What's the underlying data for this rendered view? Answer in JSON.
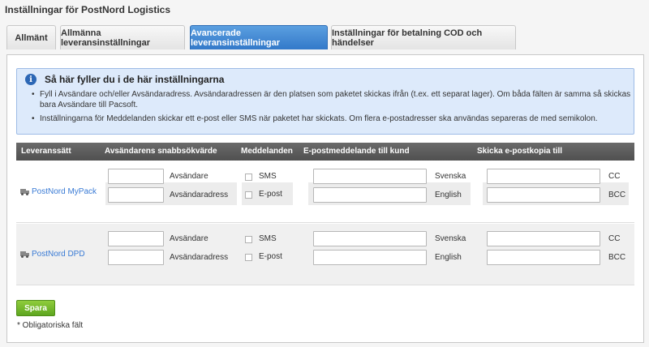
{
  "page": {
    "title": "Inställningar för PostNord Logistics"
  },
  "tabs": [
    {
      "label": "Allmänt",
      "active": false
    },
    {
      "label": "Allmänna leveransinställningar",
      "active": false
    },
    {
      "label": "Avancerade leveransinställningar",
      "active": true
    },
    {
      "label": "Inställningar för betalning COD och händelser",
      "active": false
    }
  ],
  "info": {
    "icon": "info-icon",
    "title": "Så här fyller du i de här inställningarna",
    "bullets": [
      "Fyll i Avsändare och/eller Avsändaradress. Avsändaradressen är den platsen som paketet skickas ifrån (t.ex. ett separat lager). Om båda fälten är samma så skickas bara Avsändare till Pacsoft.",
      "Inställningarna för Meddelanden skickar ett e-post eller SMS när paketet har skickats. Om flera e-postadresser ska användas separeras de med semikolon."
    ]
  },
  "table": {
    "headers": [
      "Leveranssätt",
      "Avsändarens snabbsökvärde",
      "Meddelanden",
      "E-postmeddelande till kund",
      "Skicka e-postkopia till"
    ],
    "rows": [
      {
        "method": "PostNord MyPack",
        "sender_label": "Avsändare",
        "sender_address_label": "Avsändaradress",
        "sms_label": "SMS",
        "email_label": "E-post",
        "lang_sv": "Svenska",
        "lang_en": "English",
        "cc_label": "CC",
        "bcc_label": "BCC"
      },
      {
        "method": "PostNord DPD",
        "sender_label": "Avsändare",
        "sender_address_label": "Avsändaradress",
        "sms_label": "SMS",
        "email_label": "E-post",
        "lang_sv": "Svenska",
        "lang_en": "English",
        "cc_label": "CC",
        "bcc_label": "BCC"
      }
    ]
  },
  "footer": {
    "save_label": "Spara",
    "required_note": "* Obligatoriska fält"
  },
  "colors": {
    "active_tab": "#3a7bd5",
    "save_button": "#6fb62a",
    "info_background": "#ddeafb",
    "table_header": "#5a5a5a",
    "link": "#3a7bd5"
  }
}
